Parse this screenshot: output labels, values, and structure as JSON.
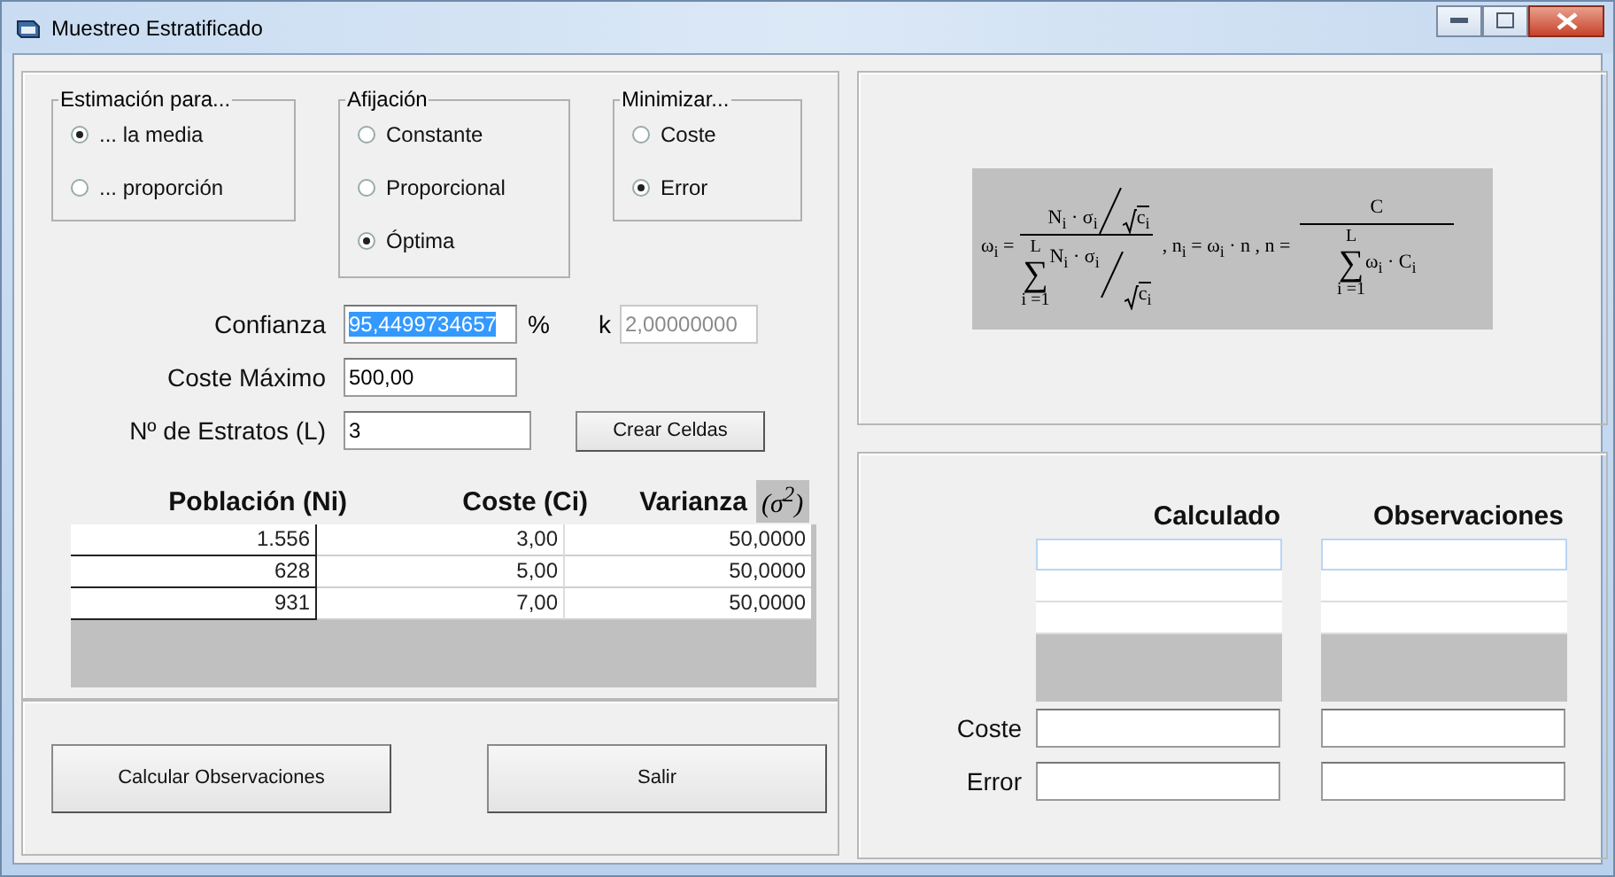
{
  "window": {
    "title": "Muestreo Estratificado"
  },
  "groups": [
    {
      "title": "Estimación para...",
      "options": [
        {
          "label": "... la media",
          "selected": true
        },
        {
          "label": "... proporción",
          "selected": false
        }
      ]
    },
    {
      "title": "Afijación",
      "options": [
        {
          "label": "Constante",
          "selected": false
        },
        {
          "label": "Proporcional",
          "selected": false
        },
        {
          "label": "Óptima",
          "selected": true
        }
      ]
    },
    {
      "title": "Minimizar...",
      "options": [
        {
          "label": "Coste",
          "selected": false
        },
        {
          "label": "Error",
          "selected": true
        }
      ]
    }
  ],
  "confianza": {
    "label": "Confianza",
    "value": "95,4499734657",
    "unit": "%",
    "k_label": "k",
    "k_value": "2,00000000"
  },
  "coste_maximo": {
    "label": "Coste Máximo",
    "value": "500,00"
  },
  "estratos": {
    "label": "Nº de Estratos (L)",
    "value": "3"
  },
  "crear_button": "Crear Celdas",
  "table": {
    "columns": [
      "Población (Ni)",
      "Coste (Ci)",
      "Varianza"
    ],
    "sigma": "(σ$^{2}$)",
    "rows": [
      [
        "1.556",
        "3,00",
        "50,0000"
      ],
      [
        "628",
        "5,00",
        "50,0000"
      ],
      [
        "931",
        "7,00",
        "50,0000"
      ]
    ]
  },
  "buttons": [
    "Calcular Observaciones",
    "Salir"
  ],
  "formula": {
    "lhs": "ω$_{i}$ =",
    "num_term": "N$_{i}$ · σ$_{i}$",
    "num_root": "c$_{i}$",
    "sum_top": "L",
    "sum_sign": "∑",
    "sum_bottom": "i =1",
    "den_term": "N$_{i}$ · σ$_{i}$",
    "den_root": "c$_{i}$",
    "middle": ", n$_{i}$ = ω$_{i}$ · n  , n =",
    "c": "C",
    "sum2_top": "L",
    "sum2_sign": "∑",
    "sum2_bottom": "i =1",
    "sum2_term": "ω$_{i}$ · C$_{i}$"
  },
  "results": {
    "columns": [
      "Calculado",
      "Observaciones"
    ],
    "fields": [
      {
        "label": "Coste"
      },
      {
        "label": "Error"
      }
    ]
  }
}
